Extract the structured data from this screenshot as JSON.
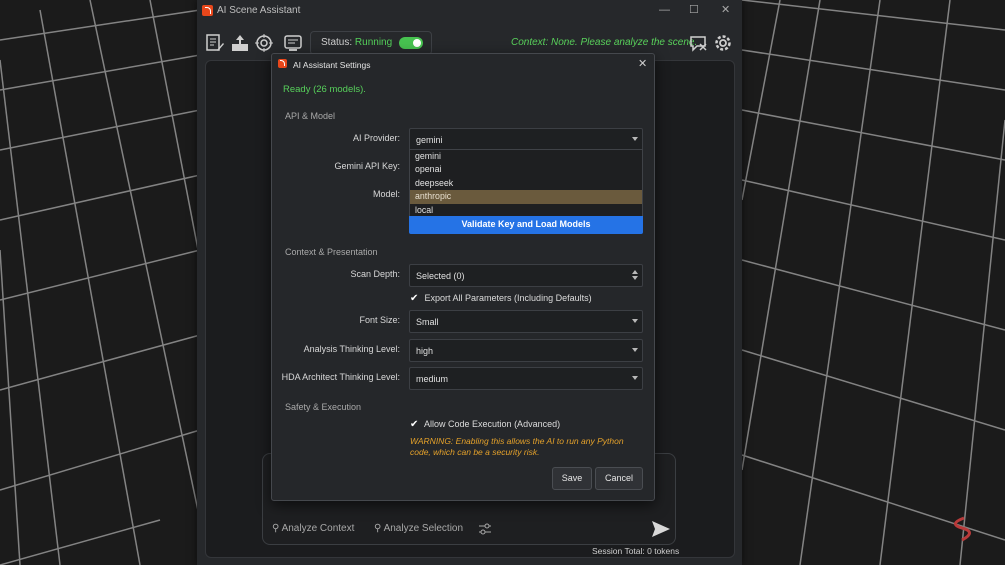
{
  "main_window": {
    "title": "AI Scene Assistant",
    "status_label": "Status:",
    "status_value": "Running",
    "context_message": "Context: None. Please analyze the scene.",
    "analyze_context_label": "Analyze Context",
    "analyze_selection_label": "Analyze Selection",
    "session_total": "Session Total: 0 tokens"
  },
  "dialog": {
    "title": "AI Assistant Settings",
    "ready_status": "Ready (26 models).",
    "sections": {
      "api_model": "API & Model",
      "context_presentation": "Context & Presentation",
      "safety_execution": "Safety & Execution"
    },
    "fields": {
      "ai_provider": {
        "label": "AI Provider:",
        "value": "gemini"
      },
      "gemini_api_key": {
        "label": "Gemini API Key:"
      },
      "model": {
        "label": "Model:"
      },
      "scan_depth": {
        "label": "Scan Depth:",
        "value": "Selected (0)"
      },
      "font_size": {
        "label": "Font Size:",
        "value": "Small"
      },
      "analysis_thinking": {
        "label": "Analysis Thinking Level:",
        "value": "high"
      },
      "hda_thinking": {
        "label": "HDA Architect Thinking Level:",
        "value": "medium"
      }
    },
    "provider_options": [
      "gemini",
      "openai",
      "deepseek",
      "anthropic",
      "local"
    ],
    "highlighted_option": "anthropic",
    "validate_button": "Validate Key and Load Models",
    "export_all_params": "Export All Parameters (Including Defaults)",
    "allow_code_exec": "Allow Code Execution (Advanced)",
    "warning_text": "WARNING: Enabling this allows the AI to run any Python code, which can be a security risk.",
    "save_button": "Save",
    "cancel_button": "Cancel"
  },
  "colors": {
    "accent_green": "#57d05b",
    "validate_blue": "#2573e6",
    "warning_orange": "#e4a12a",
    "dropdown_highlight": "#6a5a3d"
  }
}
